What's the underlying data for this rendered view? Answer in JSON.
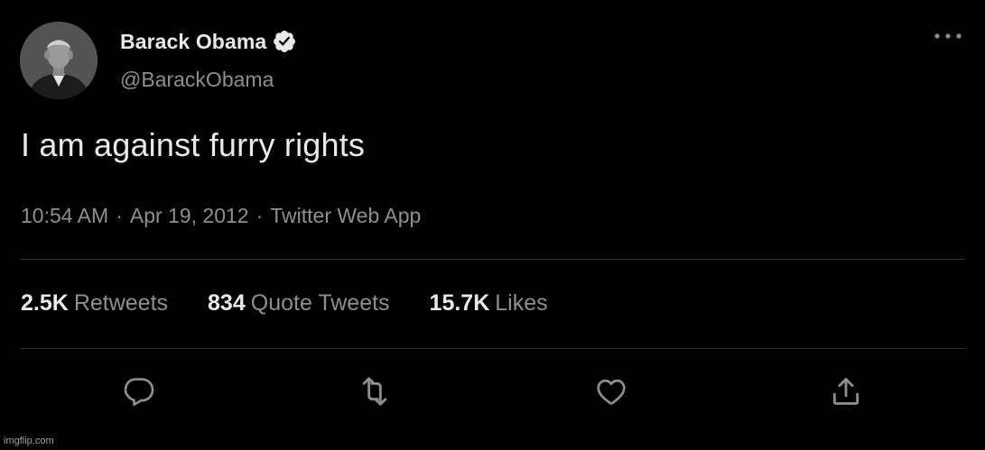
{
  "author": {
    "display_name": "Barack Obama",
    "handle": "@BarackObama",
    "verified": true
  },
  "tweet": {
    "text": "I am against furry rights",
    "time": "10:54 AM",
    "date": "Apr 19, 2012",
    "source": "Twitter Web App",
    "separator": "·"
  },
  "stats": [
    {
      "count": "2.5K",
      "label": "Retweets"
    },
    {
      "count": "834",
      "label": "Quote Tweets"
    },
    {
      "count": "15.7K",
      "label": "Likes"
    }
  ],
  "actions": {
    "reply_icon": "reply-icon",
    "retweet_icon": "retweet-icon",
    "like_icon": "heart-icon",
    "share_icon": "share-icon",
    "more_icon": "more-icon"
  },
  "watermark": "imgflip.com",
  "colors": {
    "background": "#000000",
    "primary_text": "#e7e9ea",
    "secondary_text": "#8b8f93",
    "divider": "#2f3336"
  }
}
